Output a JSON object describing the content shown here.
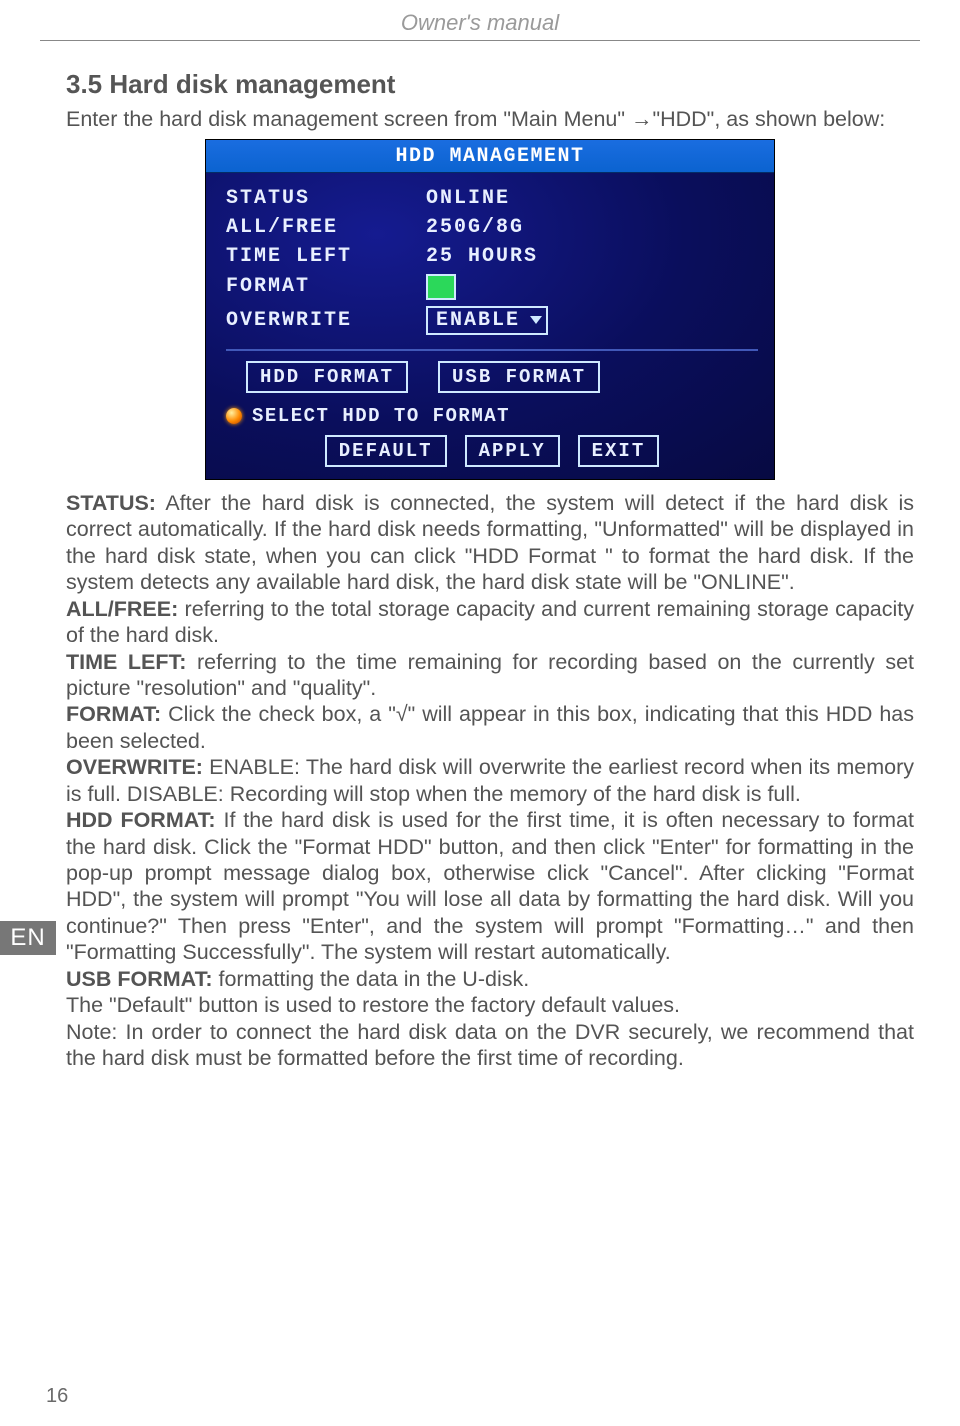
{
  "header": {
    "title": "Owner's manual"
  },
  "sidebar": {
    "lang": "EN"
  },
  "footer": {
    "pageNumber": "16"
  },
  "section": {
    "title": "3.5 Hard disk management",
    "intro": "Enter the hard disk management screen from \"Main Menu\" →\"HDD\", as shown below:"
  },
  "screenshot": {
    "title": "HDD MANAGEMENT",
    "rows": {
      "statusLabel": "STATUS",
      "statusValue": "ONLINE",
      "allFreeLabel": "ALL/FREE",
      "allFreeValue": "250G/8G",
      "timeLeftLabel": "TIME LEFT",
      "timeLeftValue": "25 HOURS",
      "formatLabel": "FORMAT",
      "overwriteLabel": "OVERWRITE",
      "overwriteValue": "ENABLE"
    },
    "buttons": {
      "hddFormat": "HDD FORMAT",
      "usbFormat": "USB FORMAT",
      "default": "DEFAULT",
      "apply": "APPLY",
      "exit": "EXIT"
    },
    "warning": "SELECT HDD TO FORMAT"
  },
  "body": {
    "statusLabel": "STATUS:",
    "statusText": " After the hard disk is connected, the system will detect if the hard disk is correct automatically. If the hard disk needs formatting, \"Unformatted\" will be displayed in the hard disk state, when you can click \"HDD Format \" to format the hard disk. If the system detects any available hard disk, the hard disk state will be \"ONLINE\".",
    "allFreeLabel": "ALL/FREE:",
    "allFreeText": " referring to the total storage capacity and current remaining storage capacity of the hard disk.",
    "timeLeftLabel": "TIME LEFT:",
    "timeLeftText": " referring to the time remaining for recording based on the currently set picture \"resolution\" and \"quality\".",
    "formatLabel": "FORMAT:",
    "formatText": " Click the check box, a \"√\" will appear in this box, indicating that this HDD has been selected.",
    "overwriteLabel": "OVERWRITE:",
    "overwriteText": " ENABLE: The hard disk will overwrite the earliest record when its memory is full. DISABLE: Recording will stop when the memory of the hard disk is full.",
    "hddFormatLabel": "HDD FORMAT:",
    "hddFormatText": " If the hard disk is used for the first time, it is often necessary to format the hard disk. Click the \"Format HDD\" button, and then click \"Enter\" for formatting in the pop-up prompt message dialog box, otherwise click \"Cancel\". After clicking \"Format HDD\", the system will prompt \"You will lose all data by formatting the hard disk. Will you continue?\" Then press \"Enter\", and the system will prompt \"Formatting…\" and then \"Formatting Successfully\". The system will restart automatically.",
    "usbFormatLabel": "USB FORMAT:",
    "usbFormatText": " formatting the data in the U-disk.",
    "defaultText": "The \"Default\" button is used to restore the factory default values.",
    "noteText": "Note: In order to connect the hard disk data on the DVR securely, we recommend that the hard disk must be formatted before the first time of recording."
  }
}
